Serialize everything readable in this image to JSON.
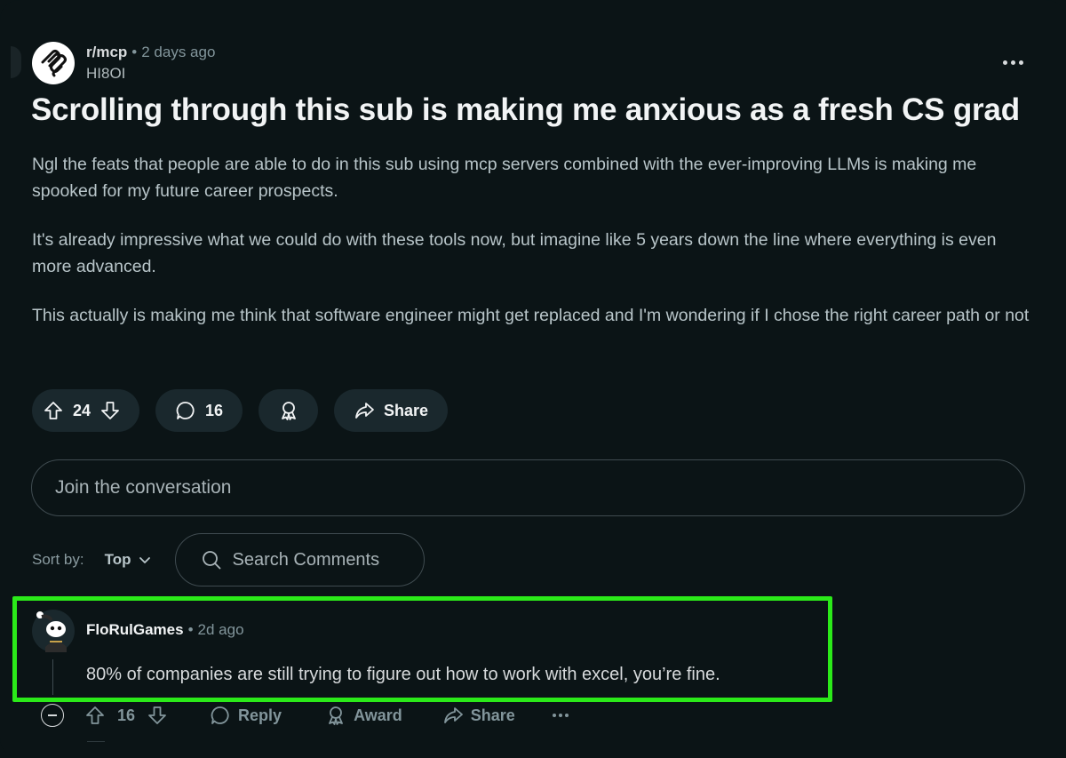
{
  "post": {
    "subreddit": "r/mcp",
    "time_ago": "2 days ago",
    "author": "HI8OI",
    "title": "Scrolling through this sub is making me anxious as a fresh CS grad",
    "paragraphs": [
      "Ngl the feats that people are able to do in this sub using mcp servers combined with the ever-improving LLMs is making me spooked for my future career prospects.",
      "It's already impressive what we could do with these tools now, but imagine like 5 years down the line where everything is even more advanced.",
      "This actually is making me think that software engineer might get replaced and I'm wondering if I chose the right career path or not"
    ],
    "votes": "24",
    "comments": "16",
    "share_label": "Share"
  },
  "join": {
    "placeholder": "Join the conversation"
  },
  "sort": {
    "label": "Sort by:",
    "value": "Top"
  },
  "search": {
    "placeholder": "Search Comments"
  },
  "comment": {
    "author": "FloRulGames",
    "time_ago": "2d ago",
    "text": "80% of companies are still trying to figure out how to work with excel, you’re fine.",
    "votes": "16",
    "reply_label": "Reply",
    "award_label": "Award",
    "share_label": "Share"
  },
  "colors": {
    "background": "#0b1416",
    "pill": "#1a282d",
    "highlight": "#2bea19"
  }
}
